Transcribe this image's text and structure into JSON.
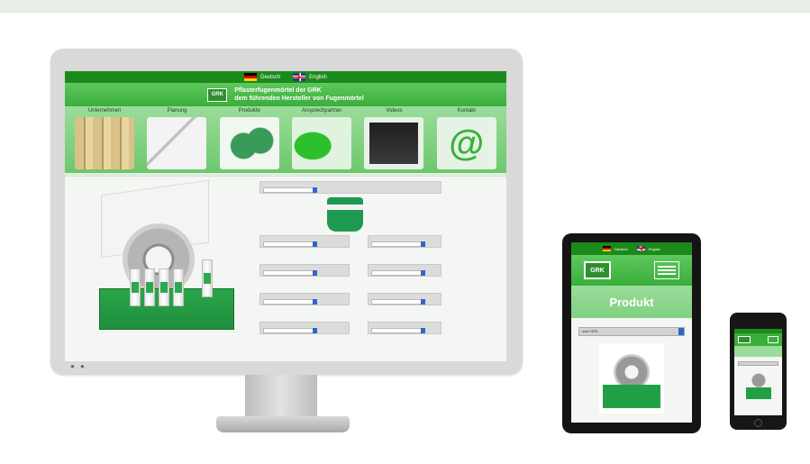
{
  "desktop": {
    "languages": [
      {
        "label": "Deutsch",
        "flag": "de-flag-icon"
      },
      {
        "label": "English",
        "flag": "uk-flag-icon"
      }
    ],
    "logo_text": "GRK",
    "tagline_line1": "Pflasterfugenmörtel der GRK",
    "tagline_line2": "dem führenden Hersteller von Fugenmörtel",
    "nav": [
      {
        "label": "Unternehmen",
        "thumb": "silo"
      },
      {
        "label": "Planung",
        "thumb": "plan"
      },
      {
        "label": "Produkte",
        "thumb": "prod"
      },
      {
        "label": "Ansprechpartner",
        "thumb": "de"
      },
      {
        "label": "Videos",
        "thumb": "cam"
      },
      {
        "label": "Kontakt",
        "thumb": "at"
      }
    ]
  },
  "tablet": {
    "languages": [
      {
        "label": "Deutsch"
      },
      {
        "label": "English"
      }
    ],
    "logo_text": "GRK",
    "title": "Produkt",
    "select_value": "oder GRK"
  },
  "colors": {
    "brand_green": "#1b8a1b",
    "light_green": "#9bdc9b",
    "select_arrow": "#2f66c9"
  }
}
